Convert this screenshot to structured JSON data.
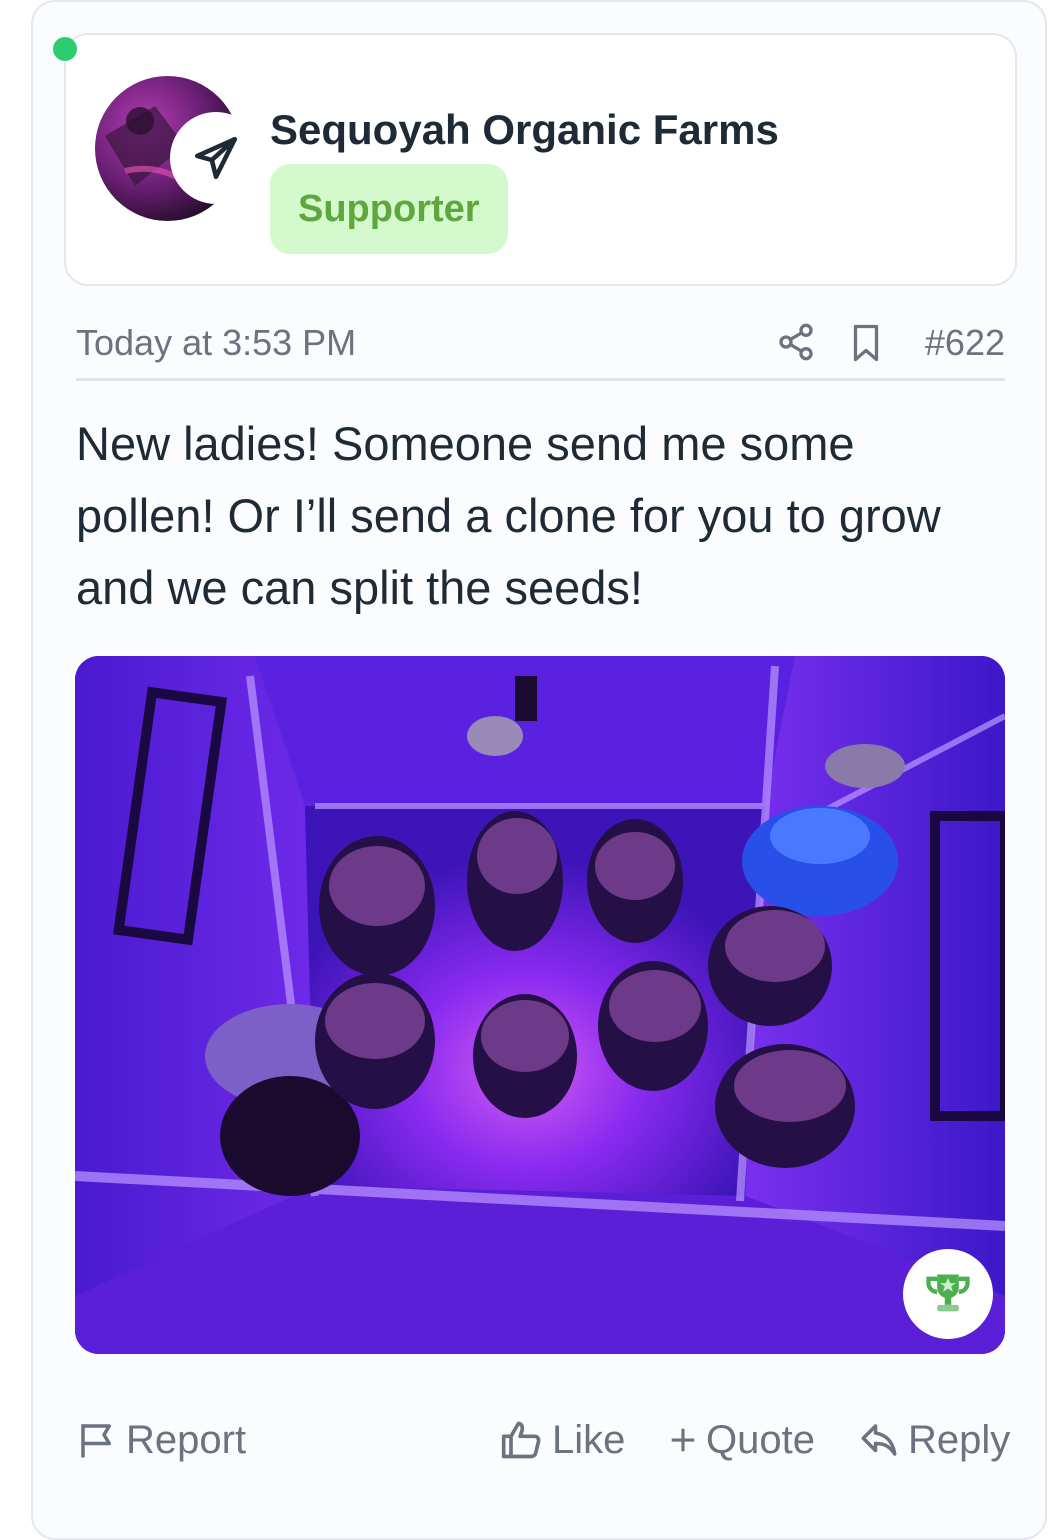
{
  "post": {
    "author": {
      "name": "Sequoyah Organic Farms",
      "role_badge": "Supporter",
      "online": true
    },
    "meta": {
      "timestamp": "Today at 3:53 PM",
      "post_number": "#622"
    },
    "message": "New ladies! Someone send me some pollen! Or I’ll send a clone for you to grow and we can split the seeds!",
    "actions": {
      "report": "Report",
      "like": "Like",
      "quote": "Quote",
      "reply": "Reply"
    }
  },
  "icons": {
    "avatar_badge": "paper-plane-icon",
    "share": "share-icon",
    "bookmark": "bookmark-icon",
    "trophy": "trophy-icon",
    "report": "flag-icon",
    "like": "thumbs-up-icon",
    "quote": "plus-icon",
    "reply": "reply-arrow-icon"
  },
  "colors": {
    "online": "#2ecc71",
    "badge_bg": "#d3f9cc",
    "badge_text": "#5fa73d",
    "grow_light": "#6a1ff0"
  }
}
